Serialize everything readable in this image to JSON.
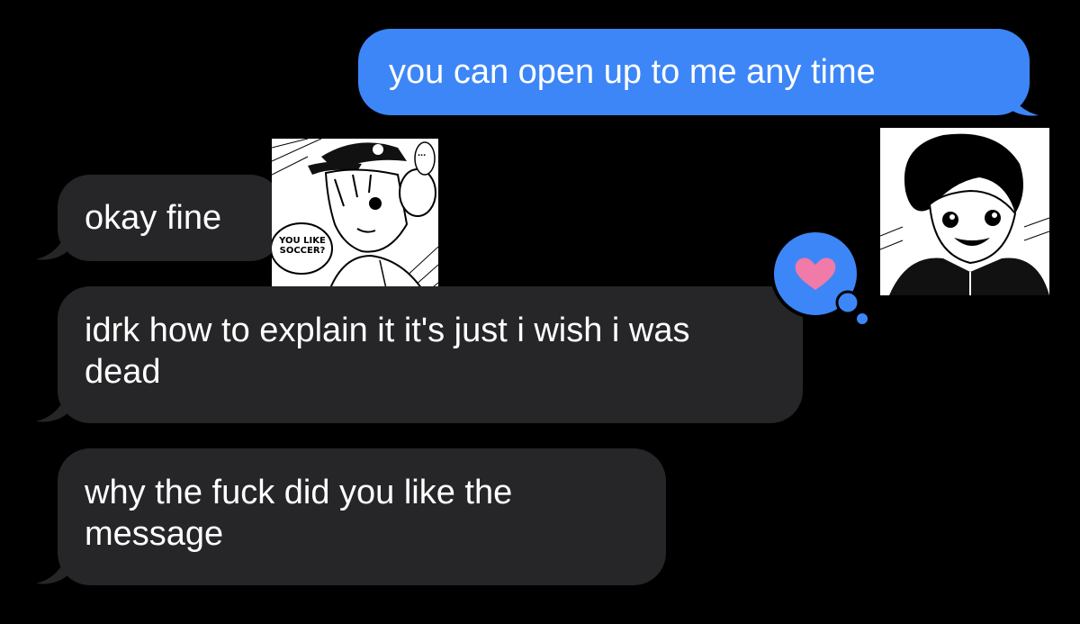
{
  "messages": [
    {
      "direction": "sent",
      "text": "you can open up to me any time"
    },
    {
      "direction": "received",
      "text": "okay fine"
    },
    {
      "direction": "received",
      "text": "idrk how to explain it it's just i wish i was dead"
    },
    {
      "direction": "received",
      "text": "why the fuck did you like the message"
    }
  ],
  "stickers": {
    "left": {
      "caption": "YOU LIKE SOCCER?",
      "dots": "..."
    }
  },
  "tapback": {
    "icon": "heart-icon",
    "color": "#f07aa8",
    "bubble_color": "#3d86f7"
  },
  "colors": {
    "sent": "#3d86f7",
    "received": "#262628",
    "background": "#000000"
  }
}
